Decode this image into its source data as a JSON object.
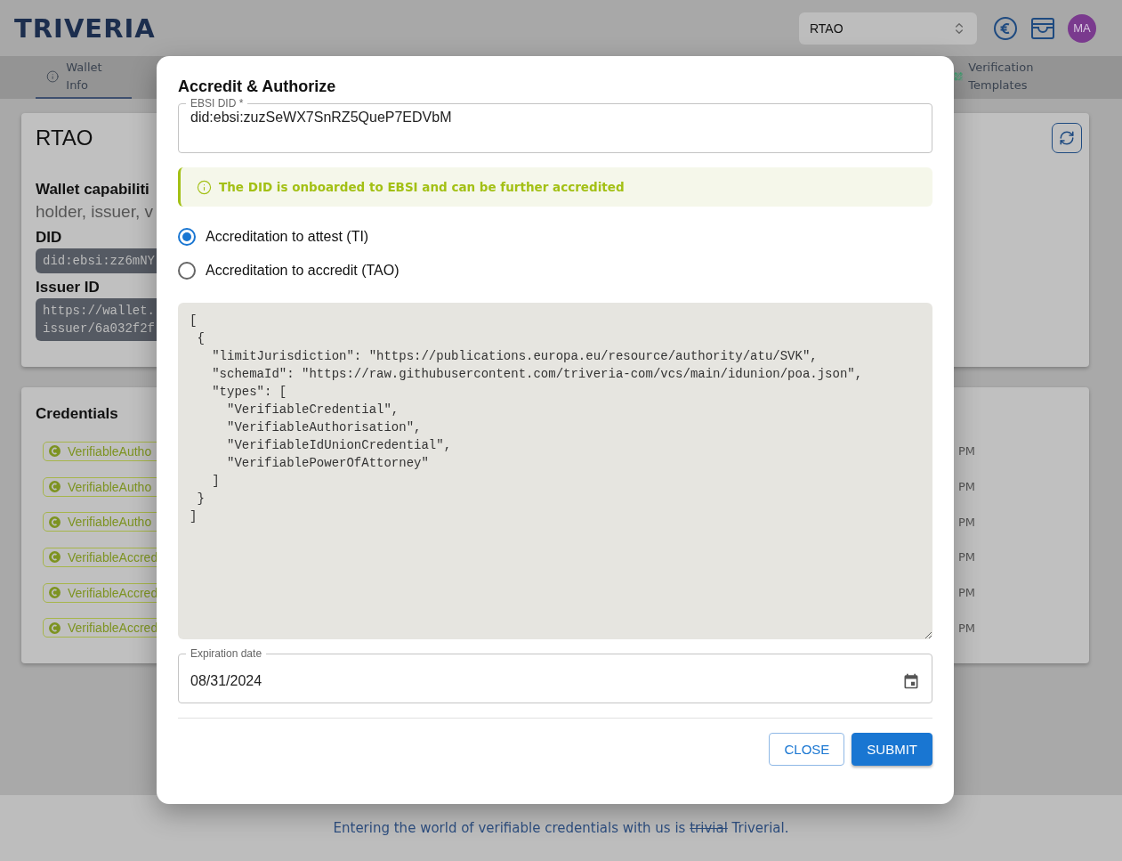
{
  "header": {
    "logo": "TRIVERIA",
    "wallet_select": {
      "value": "RTAO"
    },
    "avatar": "MA"
  },
  "nav_tabs": [
    {
      "label": "Wallet Info",
      "selected": true
    },
    {
      "label": "Verification Templates",
      "selected": false
    }
  ],
  "wallet_card": {
    "title": "RTAO",
    "capabilities_label": "Wallet capabiliti",
    "capabilities": "holder, issuer, v",
    "did_label": "DID",
    "did": "did:ebsi:zz6mNY",
    "issuer_label": "Issuer ID",
    "issuer_id": "https://wallet.\nissuer/6a032f2f"
  },
  "credentials": {
    "title": "Credentials",
    "items": [
      {
        "name": "VerifiableAutho",
        "time": "PM"
      },
      {
        "name": "VerifiableAutho",
        "time": "PM"
      },
      {
        "name": "VerifiableAutho",
        "time": "PM"
      },
      {
        "name": "VerifiableAccred",
        "time": "PM"
      },
      {
        "name": "VerifiableAccred",
        "time": "PM"
      },
      {
        "name": "VerifiableAccred",
        "time": "PM"
      }
    ]
  },
  "dialog": {
    "title": "Accredit & Authorize",
    "did_field": {
      "label": "EBSI DID *",
      "value": "did:ebsi:zuzSeWX7SnRZ5QueP7EDVbM"
    },
    "alert": "The DID is onboarded to EBSI and can be further accredited",
    "options": [
      {
        "label": "Accreditation to attest (TI)",
        "selected": true
      },
      {
        "label": "Accreditation to accredit (TAO)",
        "selected": false
      }
    ],
    "json_value": "[\n {\n   \"limitJurisdiction\": \"https://publications.europa.eu/resource/authority/atu/SVK\",\n   \"schemaId\": \"https://raw.githubusercontent.com/triveria-com/vcs/main/idunion/poa.json\",\n   \"types\": [\n     \"VerifiableCredential\",\n     \"VerifiableAuthorisation\",\n     \"VerifiableIdUnionCredential\",\n     \"VerifiablePowerOfAttorney\"\n   ]\n }\n]",
    "date_field": {
      "label": "Expiration date",
      "value": "08/31/2024"
    },
    "buttons": [
      {
        "label": "CLOSE",
        "kind": "outlined"
      },
      {
        "label": "SUBMIT",
        "kind": "contained"
      }
    ]
  },
  "footer": {
    "before": "Entering the world of verifiable credentials with us is",
    "struck": "trivial",
    "after": "Triverial."
  }
}
